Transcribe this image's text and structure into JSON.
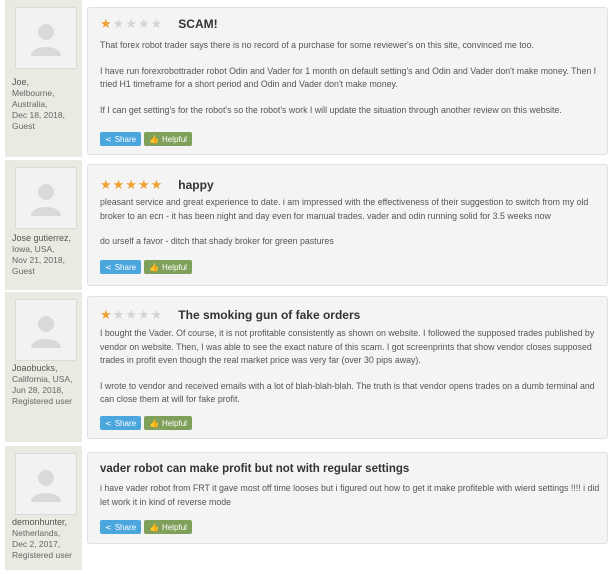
{
  "buttons": {
    "share_label": "Share",
    "helpful_label": "Helpful"
  },
  "colors": {
    "star_on": "#f0a030",
    "star_off": "#d4d4d4",
    "share": "#4aa6dd",
    "helpful": "#7fa05a"
  },
  "reviews": [
    {
      "user": {
        "name": "Joe,",
        "location": "Melbourne, Australia,",
        "date": "Dec 18, 2018,",
        "role": "Guest"
      },
      "rating": 1,
      "title": "SCAM!",
      "paragraphs": [
        "That forex robot trader says there is no record of a purchase for some reviewer's on this site, convinced me too.",
        "I have run forexrobottrader robot Odin and Vader for 1 month on default setting's and Odin and Vader don't make money. Then I tried H1 timeframe for a short period and Odin and Vader don't make money.",
        "If I can get setting's for the robot's so the robot's work I will update the situation through another review on this website."
      ]
    },
    {
      "user": {
        "name": "Jose gutierrez,",
        "location": "Iowa, USA,",
        "date": "Nov 21, 2018,",
        "role": "Guest"
      },
      "rating": 5,
      "title": "happy",
      "paragraphs": [
        "pleasant service and great experience to date. i am impressed with the effectiveness of their suggestion to switch from my old broker to an ecn - it has been night and day even for manual trades. vader and odin running solid for 3.5 weeks now",
        "do urself a favor - ditch that shady broker for green pastures"
      ]
    },
    {
      "user": {
        "name": "Joaobucks,",
        "location": "California, USA,",
        "date": "Jun 28, 2018,",
        "role": "Registered user"
      },
      "rating": 1,
      "title": "The smoking gun of fake orders",
      "paragraphs": [
        "I bought the Vader. Of course, it is not profitable consistently as shown on website. I followed the supposed trades published by vendor on website. Then, I was able to see the exact nature of this scam. I got screenprints that show vendor closes supposed trades in profit even though the real market price was very far (over 30 pips away).",
        "I wrote to vendor and received emails with a lot of blah-blah-blah. The truth is that vendor opens trades on a dumb terminal and can close them at will for fake profit."
      ]
    },
    {
      "user": {
        "name": "demonhunter,",
        "location": "Netherlands,",
        "date": "Dec 2, 2017,",
        "role": "Registered user"
      },
      "rating": null,
      "title": "vader robot can make profit but not with regular settings",
      "paragraphs": [
        "i have vader robot from FRT it gave most off time looses but i figured out how to get it make profiteble with wierd settings !!!! i did let work it in kind of reverse mode"
      ]
    }
  ]
}
